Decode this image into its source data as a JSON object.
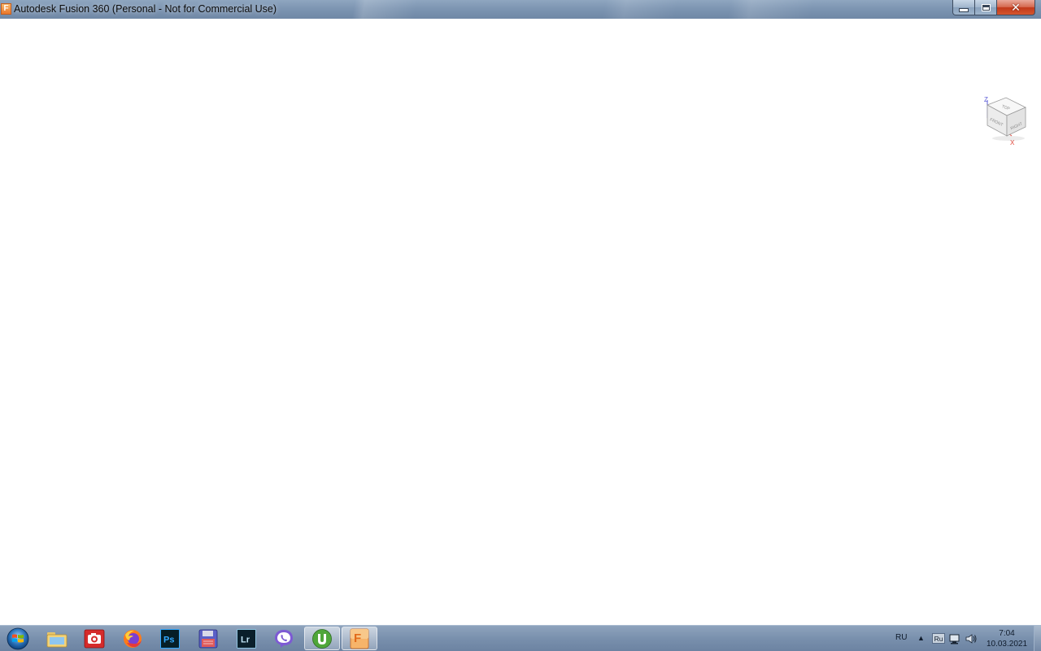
{
  "window": {
    "title": "Autodesk Fusion 360 (Personal - Not for Commercial Use)",
    "app_icon_letter": "F",
    "buttons": [
      "minimize",
      "maximize",
      "close"
    ]
  },
  "viewcube": {
    "faces": {
      "top": "TOP",
      "front": "FRONT",
      "right": "RIGHT"
    },
    "axes": {
      "z": "Z",
      "x": "X"
    },
    "colors": {
      "z_axis": "#5a5ad6",
      "x_axis": "#e0473a"
    }
  },
  "taskbar": {
    "apps": [
      {
        "name": "Windows Explorer",
        "icon": "folder-icon"
      },
      {
        "name": "Camera",
        "icon": "camera-icon"
      },
      {
        "name": "Firefox",
        "icon": "firefox-icon"
      },
      {
        "name": "Photoshop",
        "icon": "photoshop-icon",
        "label": "Ps"
      },
      {
        "name": "Save",
        "icon": "floppy-icon"
      },
      {
        "name": "Lightroom",
        "icon": "lightroom-icon",
        "label": "Lr"
      },
      {
        "name": "Viber",
        "icon": "viber-icon"
      },
      {
        "name": "uTorrent",
        "icon": "utorrent-icon"
      },
      {
        "name": "Fusion 360",
        "icon": "fusion-icon",
        "label": "F"
      }
    ],
    "tray": {
      "language": "RU",
      "keyboard_layout": "Ru",
      "time": "7:04",
      "date": "10.03.2021"
    }
  }
}
